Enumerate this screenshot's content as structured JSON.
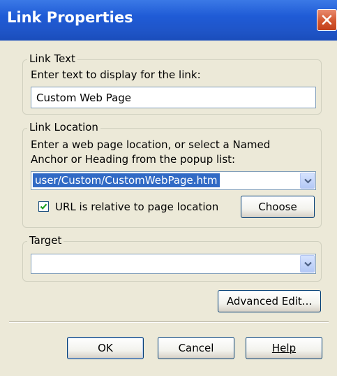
{
  "window": {
    "title": "Link Properties"
  },
  "link_text": {
    "legend": "Link Text",
    "instruction": "Enter text to display for the link:",
    "value": "Custom Web Page"
  },
  "link_location": {
    "legend": "Link Location",
    "instruction_line1": "Enter a web page location, or select a Named",
    "instruction_line2": "Anchor or Heading from the popup list:",
    "value": "user/Custom/CustomWebPage.htm",
    "relative_checkbox_label": "URL is relative to page location",
    "relative_checked": true,
    "choose_label": "Choose"
  },
  "target": {
    "legend": "Target",
    "value": ""
  },
  "buttons": {
    "advanced_edit": "Advanced Edit...",
    "ok": "OK",
    "cancel": "Cancel",
    "help": "Help"
  }
}
